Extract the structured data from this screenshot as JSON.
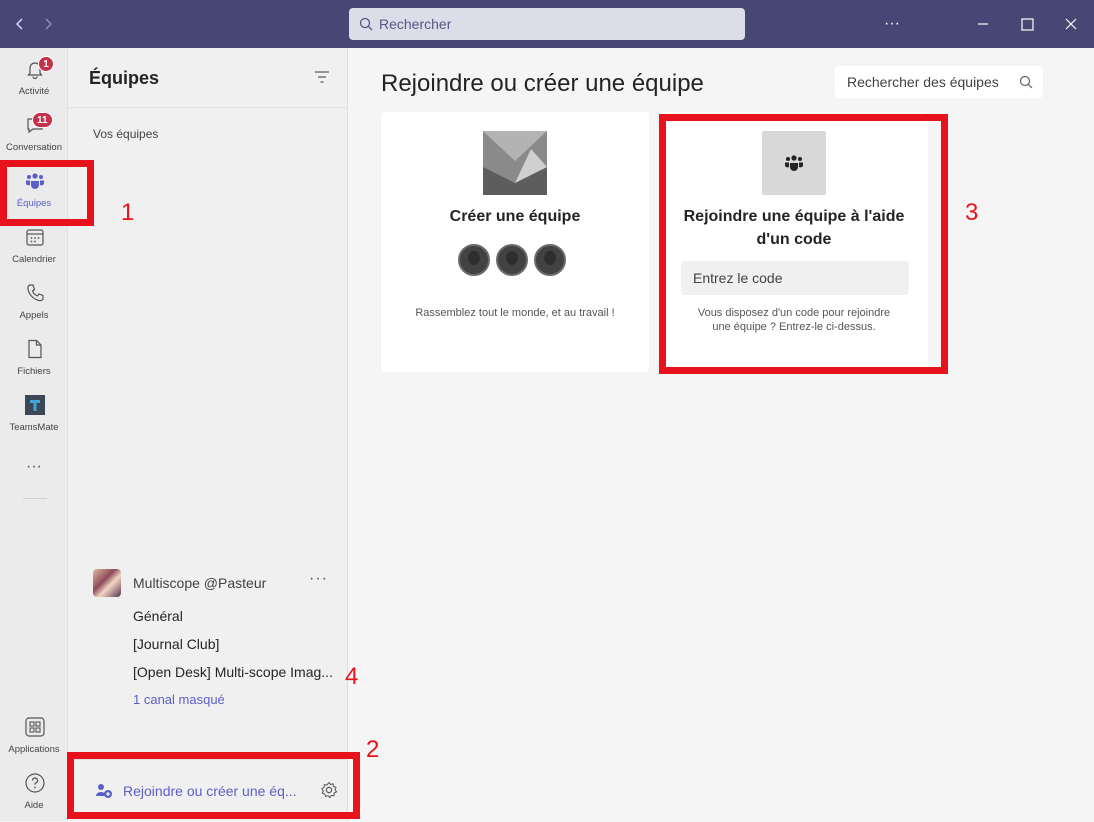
{
  "titlebar": {
    "search_placeholder": "Rechercher",
    "more": "···",
    "back_icon": "chevron-left-icon",
    "forward_icon": "chevron-right-icon"
  },
  "rail": {
    "items": [
      {
        "label": "Activité",
        "icon": "bell-icon",
        "badge": "1"
      },
      {
        "label": "Conversation",
        "icon": "chat-icon",
        "badge": "11"
      },
      {
        "label": "Équipes",
        "icon": "teams-icon",
        "active": true
      },
      {
        "label": "Calendrier",
        "icon": "calendar-icon"
      },
      {
        "label": "Appels",
        "icon": "phone-icon"
      },
      {
        "label": "Fichiers",
        "icon": "file-icon"
      },
      {
        "label": "TeamsMate",
        "icon": "teamsmate-app-icon"
      }
    ],
    "more": "···",
    "bottom": [
      {
        "label": "Applications",
        "icon": "apps-icon"
      },
      {
        "label": "Aide",
        "icon": "help-icon"
      }
    ],
    "accent": "#5b5fc7",
    "badge_color": "#c4314b"
  },
  "panel": {
    "title": "Équipes",
    "section_label": "Vos équipes",
    "team": {
      "name": "Multiscope @Pasteur",
      "more": "···",
      "channels": [
        "Général",
        "[Journal Club]",
        "[Open Desk] Multi-scope Imag..."
      ],
      "hidden_channels": "1 canal masqué"
    },
    "join_create": "Rejoindre ou créer une éq..."
  },
  "main": {
    "title": "Rejoindre ou créer une équipe",
    "search_placeholder": "Rechercher des équipes",
    "create_card": {
      "heading": "Créer une équipe",
      "description": "Rassemblez tout le monde, et au travail !"
    },
    "join_card": {
      "heading_line1": "Rejoindre une équipe à l'aide",
      "heading_line2": "d'un code",
      "code_placeholder": "Entrez le code",
      "description": "Vous disposez d'un code pour rejoindre une équipe ? Entrez-le ci-dessus."
    }
  },
  "annotations": [
    "1",
    "2",
    "3",
    "4"
  ],
  "colors": {
    "titlebar": "#464775",
    "annotation": "#e8121c"
  }
}
